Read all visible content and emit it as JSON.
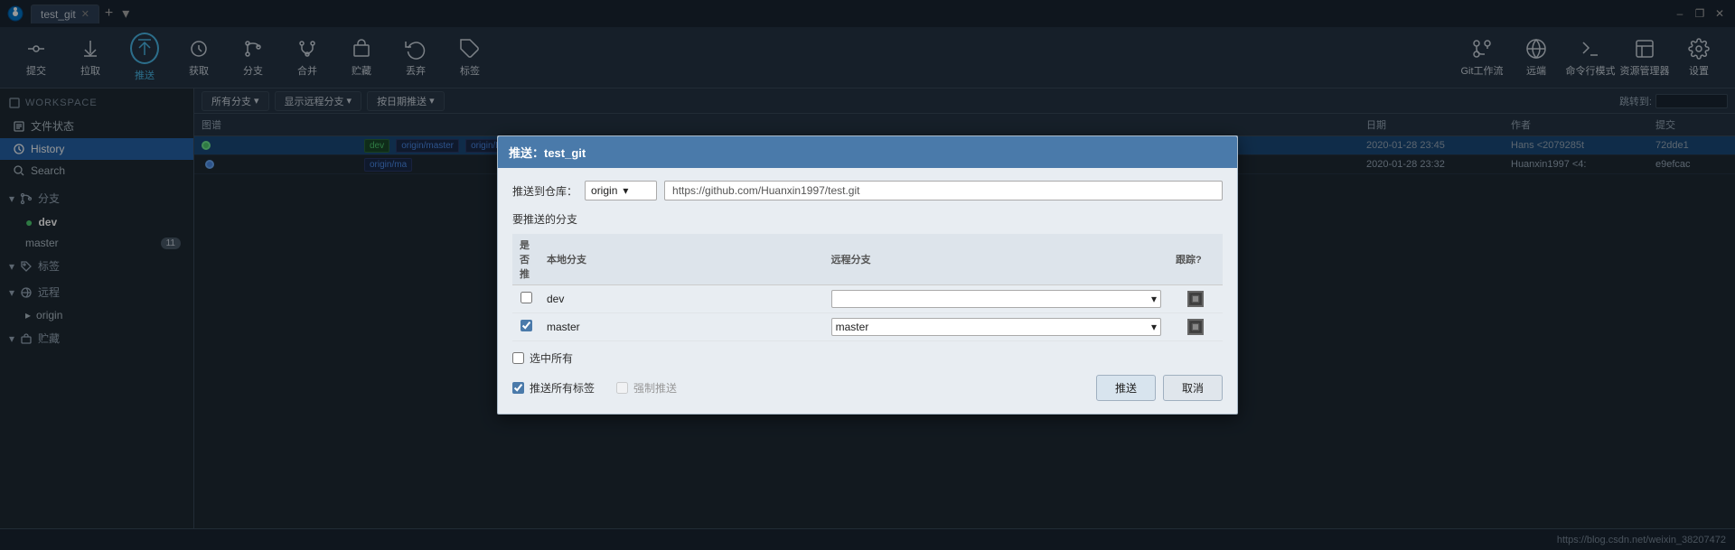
{
  "titlebar": {
    "logo_alt": "Sourcetree logo",
    "tab_label": "test_git",
    "btn_minimize": "–",
    "btn_restore": "❐",
    "btn_close": "✕",
    "tab_add": "+",
    "tab_dropdown": "▾"
  },
  "toolbar": {
    "commit_label": "提交",
    "pull_label": "拉取",
    "push_label": "推送",
    "fetch_label": "获取",
    "branch_label": "分支",
    "merge_label": "合并",
    "stash_label": "贮藏",
    "discard_label": "丢弃",
    "tag_label": "标签",
    "git_flow_label": "Git工作流",
    "remote_label": "远端",
    "terminal_label": "命令行模式",
    "explorer_label": "资源管理器",
    "settings_label": "设置"
  },
  "content_toolbar": {
    "all_branches": "所有分支",
    "show_remote": "显示远程分支",
    "by_date": "按日期推送",
    "jump_label": "跳转到:"
  },
  "sidebar": {
    "workspace_label": "WORKSPACE",
    "file_status_label": "文件状态",
    "history_label": "History",
    "search_label": "Search",
    "branches_label": "分支",
    "branch_dev": "dev",
    "branch_master": "master",
    "branch_master_badge": "11",
    "tags_label": "标签",
    "remote_label": "远程",
    "remote_origin": "origin",
    "stash_label": "贮藏"
  },
  "commit_table": {
    "headers": [
      "图谱",
      "",
      "日期",
      "作者",
      "提交"
    ],
    "rows": [
      {
        "branch_tags": [
          "dev",
          "origin/master",
          "origin/HEAD"
        ],
        "message": "",
        "date": "2020-01-28 23:45",
        "author": "Hans <2079285t",
        "commit": "72dde1"
      },
      {
        "branch_tags": [
          "origin/ma"
        ],
        "message": "",
        "date": "2020-01-28 23:32",
        "author": "Huanxin1997 <4:",
        "commit": "e9efcac"
      }
    ]
  },
  "modal": {
    "title": "推送：test_git",
    "repo_label": "推送到仓库：",
    "repo_selected": "origin",
    "repo_url": "https://github.com/Huanxin1997/test.git",
    "branches_title": "要推送的分支",
    "col_push": "是否推",
    "col_local": "本地分支",
    "col_remote": "远程分支",
    "col_track": "跟踪?",
    "branch_dev": "dev",
    "branch_master": "master",
    "dev_checked": false,
    "master_checked": true,
    "dev_remote": "",
    "master_remote": "master",
    "select_all_label": "选中所有",
    "select_all_checked": false,
    "push_tags_label": "推送所有标签",
    "push_tags_checked": true,
    "force_push_label": "强制推送",
    "force_push_checked": false,
    "push_btn": "推送",
    "cancel_btn": "取消"
  },
  "status_bar": {
    "url": "https://blog.csdn.net/weixin_38207472"
  }
}
